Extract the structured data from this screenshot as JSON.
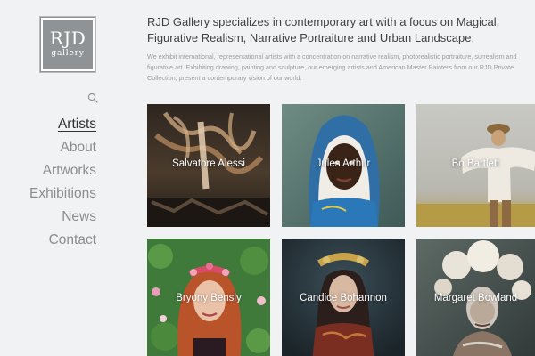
{
  "logo": {
    "main": "RJD",
    "sub": "gallery"
  },
  "nav": {
    "items": [
      {
        "label": "Artists",
        "active": true
      },
      {
        "label": "About"
      },
      {
        "label": "Artworks"
      },
      {
        "label": "Exhibitions"
      },
      {
        "label": "News"
      },
      {
        "label": "Contact"
      }
    ]
  },
  "header": {
    "headline": "RJD Gallery specializes in contemporary art with a focus on Magical, Figurative Realism, Narrative Portraiture and Urban Landscape.",
    "intro": "We exhibit international, representational artists with a concentration on narrative realism, photorealistic portraiture, surrealism and figurative art. Exhibiting drawing, painting and sculpture, our emerging artists and American Master Painters from our RJD Private Collection, present a contemporary vision of our world."
  },
  "artists": [
    {
      "name": "Salvatore Alessi"
    },
    {
      "name": "Jules Arthur"
    },
    {
      "name": "Bo Bartlett"
    },
    {
      "name": "Bryony Bensly"
    },
    {
      "name": "Candice Bohannon"
    },
    {
      "name": "Margaret Bowland"
    }
  ],
  "colors": {
    "background": "#f1f2f4",
    "logo_fill": "#8f9396",
    "nav_text": "#8a8d90",
    "nav_active": "#2f3133",
    "headline_text": "#3e4144",
    "intro_text": "#9a9da0"
  },
  "icons": {
    "search": "search-icon"
  }
}
